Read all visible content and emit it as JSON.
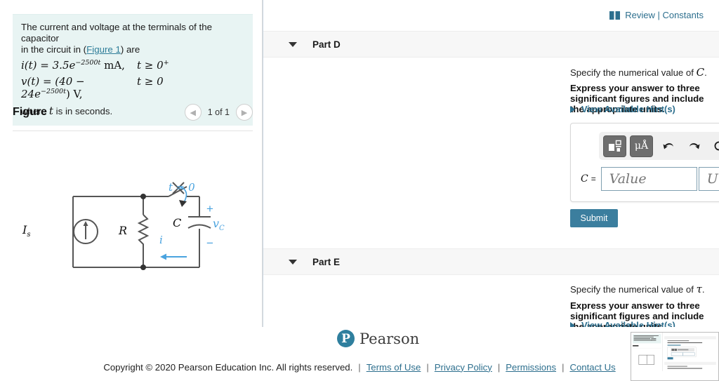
{
  "problem": {
    "line1": "The current and voltage at the terminals of the capacitor",
    "line2_pre": "in the circuit in (",
    "figure_link": "Figure 1",
    "line2_post": ") are",
    "equations": [
      {
        "lhs": "i(t) = 3.5e",
        "exp": "−2500t",
        "unit": " mA,",
        "cond": "t ≥ 0",
        "cond_sup": "+"
      },
      {
        "lhs": "v(t) = (40 − 24e",
        "exp": "−2500t",
        "unit": ") V,",
        "cond": "t ≥ 0",
        "cond_sup": ""
      }
    ],
    "where": "where t is in seconds."
  },
  "figure": {
    "title": "Figure",
    "count": "1 of 1",
    "prev_icon": "chevron-left-icon",
    "next_icon": "chevron-right-icon",
    "circuit": {
      "source_label": "I",
      "source_sub": "s",
      "resistor_label": "R",
      "capacitor_label": "C",
      "voltage_label": "v",
      "voltage_sub": "C",
      "switch_label": "t = 0",
      "current_label": "i",
      "plus": "+",
      "minus": "−",
      "accent_color": "#4aa3df",
      "wire_color": "#555555"
    }
  },
  "header": {
    "review_icon": "book-icon",
    "review_text": "Review | Constants"
  },
  "parts": [
    {
      "id": "part-d",
      "label": "Part D",
      "caret_icon": "caret-down-icon",
      "question_pre": "Specify the numerical value of ",
      "question_symbol": "C",
      "question_post": ".",
      "instruction": "Express your answer to three significant figures and include the appropriate units.",
      "hint_icon": "caret-right-icon",
      "hint_text": "View Available Hint(s)"
    },
    {
      "id": "part-e",
      "label": "Part E",
      "caret_icon": "caret-down-icon",
      "question_pre": "Specify the numerical value of ",
      "question_symbol": "τ",
      "question_post": ".",
      "instruction": "Express your answer to three significant figures and include the appropriate units.",
      "hint_icon": "caret-right-icon",
      "hint_text": "View Available Hint(s)"
    }
  ],
  "answer": {
    "toolbar": [
      {
        "name": "math-template-icon",
        "glyph": "",
        "style": "dark"
      },
      {
        "name": "units-icon",
        "glyph": "μÅ",
        "style": "dark"
      },
      {
        "name": "undo-icon",
        "glyph": "↩",
        "style": "plain"
      },
      {
        "name": "redo-icon",
        "glyph": "↪",
        "style": "plain"
      },
      {
        "name": "reset-icon",
        "glyph": "↻",
        "style": "plain"
      },
      {
        "name": "keyboard-icon",
        "glyph": "⌨",
        "style": "plain"
      },
      {
        "name": "help-icon",
        "glyph": "?",
        "style": "plain"
      }
    ],
    "variable": "C",
    "equals": "=",
    "value_placeholder": "Value",
    "value": "",
    "units_placeholder": "Units",
    "units": "",
    "submit_label": "Submit"
  },
  "branding": {
    "logo_letter": "P",
    "logo_word": "Pearson",
    "logo_color": "#2f7f9e"
  },
  "footer": {
    "copyright": "Copyright © 2020 Pearson Education Inc. All rights reserved.",
    "separator": "|",
    "links": [
      {
        "label": "Terms of Use"
      },
      {
        "label": "Privacy Policy"
      },
      {
        "label": "Permissions"
      },
      {
        "label": "Contact Us"
      }
    ]
  }
}
